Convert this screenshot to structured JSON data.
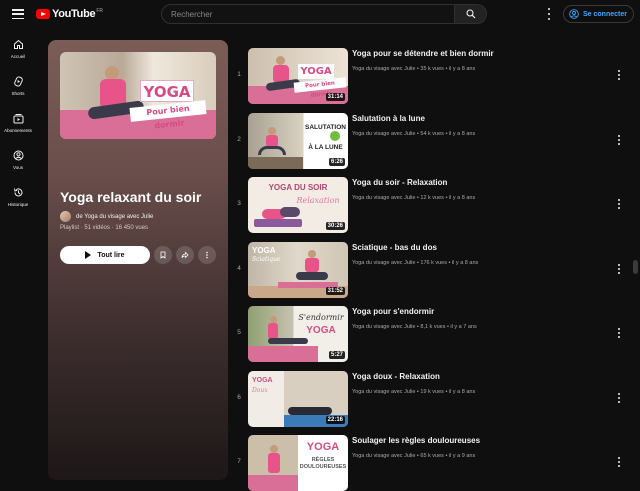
{
  "header": {
    "logo_text": "YouTube",
    "region": "FR",
    "search_placeholder": "Rechercher",
    "signin_label": "Se connecter"
  },
  "sidebar": {
    "items": [
      {
        "label": "Accueil",
        "icon": "home-icon"
      },
      {
        "label": "Shorts",
        "icon": "shorts-icon"
      },
      {
        "label": "Abonnements",
        "icon": "subscriptions-icon"
      },
      {
        "label": "Vous",
        "icon": "you-icon"
      },
      {
        "label": "Historique",
        "icon": "history-icon"
      }
    ]
  },
  "playlist": {
    "title": "Yoga relaxant du soir",
    "owner": "de Yoga du visage avec Julie",
    "meta": "Playlist · 51 vidéos · 16 450 vues",
    "play_label": "Tout lire",
    "thumb_word": "YOGA",
    "thumb_caption": "Pour bien dormir"
  },
  "videos": [
    {
      "index": "1",
      "title": "Yoga pour se détendre et bien dormir",
      "meta": "Yoga du visage avec Julie • 35 k vues • il y a 8 ans",
      "duration": "31:14",
      "thumb_text": "YOGA",
      "thumb_sub": "Pour bien dormir"
    },
    {
      "index": "2",
      "title": "Salutation à la lune",
      "meta": "Yoga du visage avec Julie • 54 k vues • il y a 8 ans",
      "duration": "6:26",
      "thumb_text": "SALUTATION",
      "thumb_sub": "À LA LUNE"
    },
    {
      "index": "3",
      "title": "Yoga du soir - Relaxation",
      "meta": "Yoga du visage avec Julie • 12 k vues • il y a 8 ans",
      "duration": "30:26",
      "thumb_text": "YOGA DU SOIR",
      "thumb_sub": "Relaxation"
    },
    {
      "index": "4",
      "title": "Sciatique - bas du dos",
      "meta": "Yoga du visage avec Julie • 176 k vues • il y a 8 ans",
      "duration": "31:52",
      "thumb_text": "YOGA",
      "thumb_sub": "Sciatique"
    },
    {
      "index": "5",
      "title": "Yoga pour s'endormir",
      "meta": "Yoga du visage avec Julie • 8,1 k vues • il y a 7 ans",
      "duration": "5:27",
      "thumb_text": "S'endormir",
      "thumb_sub": "YOGA"
    },
    {
      "index": "6",
      "title": "Yoga doux - Relaxation",
      "meta": "Yoga du visage avec Julie • 19 k vues • il y a 8 ans",
      "duration": "22:16",
      "thumb_text": "YOGA",
      "thumb_sub": "Doux"
    },
    {
      "index": "7",
      "title": "Soulager les règles douloureuses",
      "meta": "Yoga du visage avec Julie • 65 k vues • il y a 9 ans",
      "duration": "",
      "thumb_text": "YOGA",
      "thumb_sub": "RÈGLES DOULOUREUSES"
    }
  ],
  "colors": {
    "accent": "#3ea6ff",
    "brand": "#ff0000",
    "pink": "#d84a82"
  }
}
